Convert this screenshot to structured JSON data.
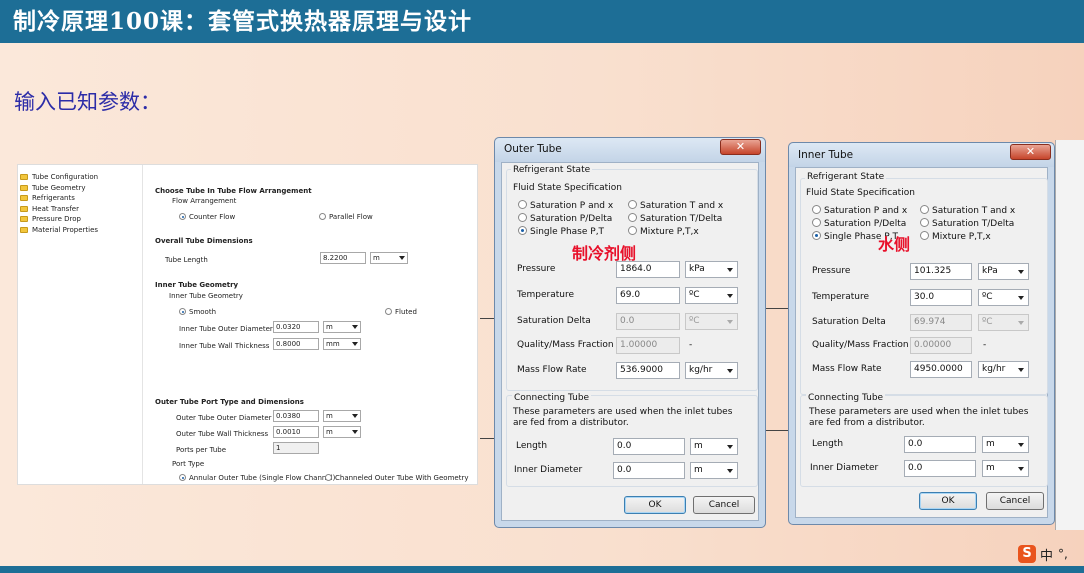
{
  "slide": {
    "title": "制冷原理100课：套管式换热器原理与设计",
    "subtitle": "输入已知参数："
  },
  "app": {
    "tree": [
      "Tube Configuration",
      "Tube Geometry",
      "Refrigerants",
      "Heat Transfer",
      "Pressure Drop",
      "Material Properties"
    ],
    "arrangement": {
      "heading": "Choose Tube In Tube Flow Arrangement",
      "group": "Flow Arrangement",
      "counter": "Counter Flow",
      "parallel": "Parallel Flow"
    },
    "overall": {
      "heading": "Overall Tube Dimensions",
      "length_label": "Tube Length",
      "length_value": "8.2200",
      "length_unit": "m"
    },
    "inner": {
      "heading": "Inner Tube Geometry",
      "group": "Inner Tube Geometry",
      "smooth": "Smooth",
      "fluted": "Fluted",
      "od_label": "Inner Tube Outer Diameter",
      "od_value": "0.0320",
      "od_unit": "m",
      "wall_label": "Inner Tube Wall Thickness",
      "wall_value": "0.8000",
      "wall_unit": "mm"
    },
    "outer": {
      "heading": "Outer Tube Port Type and Dimensions",
      "od_label": "Outer Tube Outer Diameter",
      "od_value": "0.0380",
      "od_unit": "m",
      "wall_label": "Outer Tube Wall Thickness",
      "wall_value": "0.0010",
      "wall_unit": "m",
      "ports_label": "Ports per Tube",
      "ports_value": "1",
      "port_type": "Port Type",
      "annular": "Annular Outer Tube (Single Flow Channel)",
      "channeled": "Channeled Outer Tube With Geometry"
    }
  },
  "outer_dialog": {
    "title": "Outer Tube",
    "close": "✕",
    "refrig_group": "Refrigerant State",
    "fluid_spec": "Fluid State Specification",
    "opt_sat_px": "Saturation P and x",
    "opt_sat_tx": "Saturation T and x",
    "opt_sat_pd": "Saturation P/Delta",
    "opt_sat_td": "Saturation T/Delta",
    "opt_single": "Single Phase P,T",
    "opt_mix": "Mixture P,T,x",
    "pressure_label": "Pressure",
    "pressure_value": "1864.0",
    "pressure_unit": "kPa",
    "temp_label": "Temperature",
    "temp_value": "69.0",
    "temp_unit": "ºC",
    "satd_label": "Saturation Delta",
    "satd_value": "0.0",
    "satd_unit": "ºC",
    "quality_label": "Quality/Mass Fraction",
    "quality_value": "1.00000",
    "quality_unit": "-",
    "mfr_label": "Mass Flow Rate",
    "mfr_value": "536.9000",
    "mfr_unit": "kg/hr",
    "conn_group": "Connecting Tube",
    "conn_desc": "These parameters are used when the inlet tubes are fed from a distributor.",
    "length_label": "Length",
    "length_value": "0.0",
    "length_unit": "m",
    "id_label": "Inner Diameter",
    "id_value": "0.0",
    "id_unit": "m",
    "ok": "OK",
    "cancel": "Cancel"
  },
  "inner_dialog": {
    "title": "Inner Tube",
    "close": "✕",
    "refrig_group": "Refrigerant State",
    "fluid_spec": "Fluid State Specification",
    "opt_sat_px": "Saturation P and x",
    "opt_sat_tx": "Saturation T and x",
    "opt_sat_pd": "Saturation P/Delta",
    "opt_sat_td": "Saturation T/Delta",
    "opt_single": "Single Phase P,T",
    "opt_mix": "Mixture P,T,x",
    "pressure_label": "Pressure",
    "pressure_value": "101.325",
    "pressure_unit": "kPa",
    "temp_label": "Temperature",
    "temp_value": "30.0",
    "temp_unit": "ºC",
    "satd_label": "Saturation Delta",
    "satd_value": "69.974",
    "satd_unit": "ºC",
    "quality_label": "Quality/Mass Fraction",
    "quality_value": "0.00000",
    "quality_unit": "-",
    "mfr_label": "Mass Flow Rate",
    "mfr_value": "4950.0000",
    "mfr_unit": "kg/hr",
    "conn_group": "Connecting Tube",
    "conn_desc": "These parameters are used when the inlet tubes are fed from a distributor.",
    "length_label": "Length",
    "length_value": "0.0",
    "length_unit": "m",
    "id_label": "Inner Diameter",
    "id_value": "0.0",
    "id_unit": "m",
    "ok": "OK",
    "cancel": "Cancel"
  },
  "annotations": {
    "refrigerant_side": "制冷剂侧",
    "water_side": "水侧"
  },
  "ime": {
    "logo": "S",
    "lang": "中",
    "punct": "°,"
  },
  "colors": {
    "header": "#1d6e96",
    "annotation": "#e8102a",
    "subtitle": "#2c2ca8"
  }
}
